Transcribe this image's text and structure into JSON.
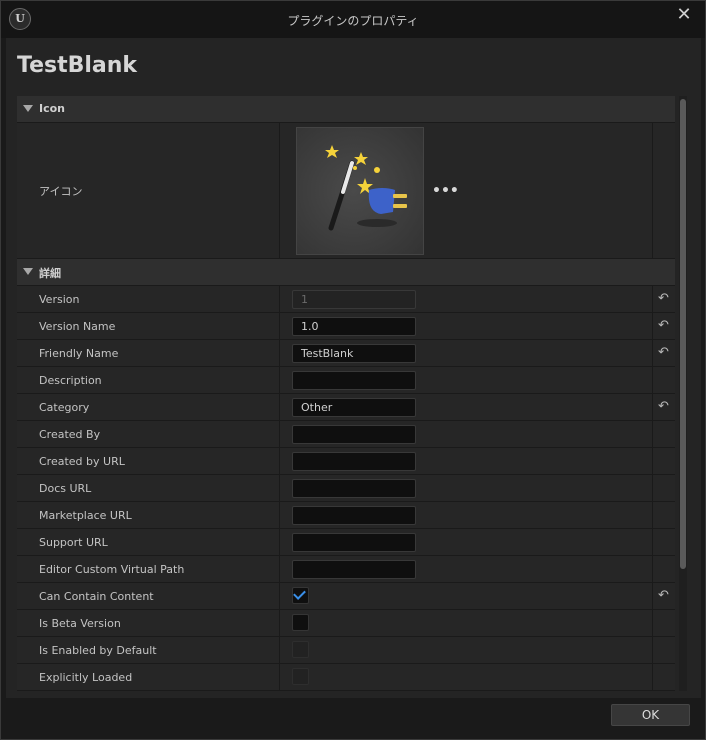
{
  "window": {
    "title": "プラグインのプロパティ",
    "close_label": "✕",
    "logo_label": "U"
  },
  "heading": "TestBlank",
  "sections": {
    "icon": {
      "label": "Icon",
      "row_label": "アイコン",
      "menu_label": "•••"
    },
    "details": {
      "label": "詳細"
    }
  },
  "rows": [
    {
      "label": "Version",
      "type": "text",
      "value": "1",
      "disabled": true,
      "reset": true
    },
    {
      "label": "Version Name",
      "type": "text",
      "value": "1.0",
      "reset": true
    },
    {
      "label": "Friendly Name",
      "type": "text",
      "value": "TestBlank",
      "reset": true
    },
    {
      "label": "Description",
      "type": "text",
      "value": "",
      "reset": false
    },
    {
      "label": "Category",
      "type": "text",
      "value": "Other",
      "reset": true
    },
    {
      "label": "Created By",
      "type": "text",
      "value": "",
      "reset": false
    },
    {
      "label": "Created by URL",
      "type": "text",
      "value": "",
      "reset": false
    },
    {
      "label": "Docs URL",
      "type": "text",
      "value": "",
      "reset": false
    },
    {
      "label": "Marketplace URL",
      "type": "text",
      "value": "",
      "reset": false
    },
    {
      "label": "Support URL",
      "type": "text",
      "value": "",
      "reset": false
    },
    {
      "label": "Editor Custom Virtual Path",
      "type": "text",
      "value": "",
      "reset": false
    },
    {
      "label": "Can Contain Content",
      "type": "check",
      "checked": true,
      "reset": true
    },
    {
      "label": "Is Beta Version",
      "type": "check",
      "checked": false,
      "reset": false
    },
    {
      "label": "Is Enabled by Default",
      "type": "check",
      "checked": false,
      "disabled": true,
      "reset": false
    },
    {
      "label": "Explicitly Loaded",
      "type": "check",
      "checked": false,
      "disabled": true,
      "reset": false
    }
  ],
  "reset_glyph": "↶",
  "ok_label": "OK",
  "colors": {
    "accent": "#3a8fe8",
    "background": "#242424",
    "panel": "#1a1a1a"
  }
}
